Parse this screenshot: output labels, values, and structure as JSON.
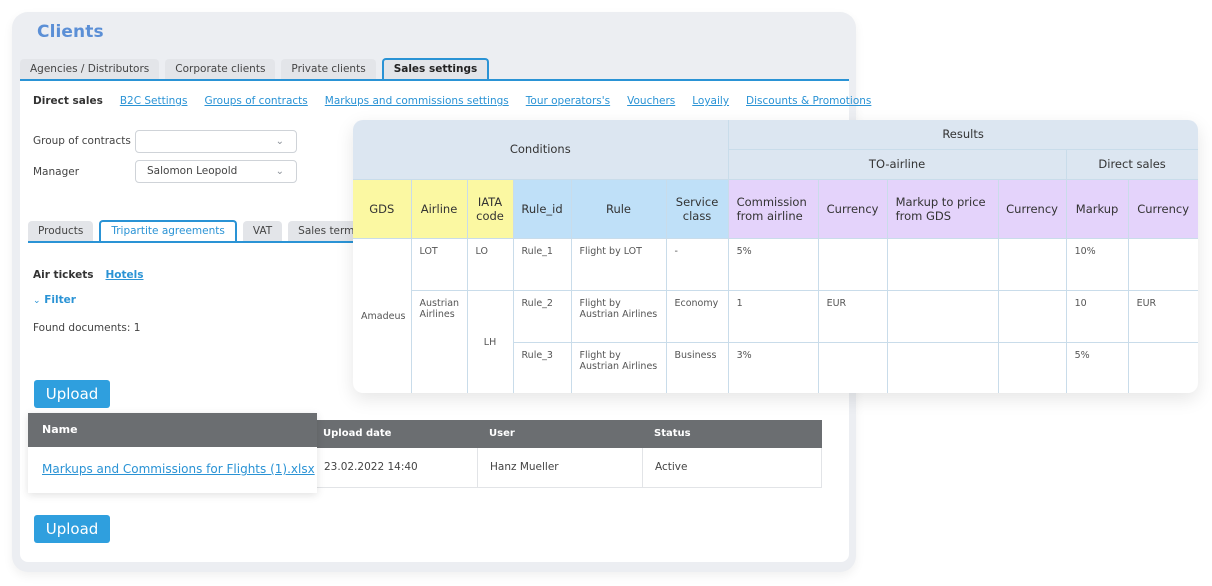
{
  "page": {
    "title": "Clients"
  },
  "top_tabs": [
    {
      "label": "Agencies / Distributors",
      "active": false
    },
    {
      "label": "Corporate clients",
      "active": false
    },
    {
      "label": "Private clients",
      "active": false
    },
    {
      "label": "Sales settings",
      "active": true
    }
  ],
  "subnav": {
    "current": "Direct sales",
    "links": [
      "B2C Settings",
      "Groups of contracts",
      "Markups and commissions settings",
      "Tour operators's",
      "Vouchers",
      "Loyaily",
      "Discounts & Promotions"
    ]
  },
  "form": {
    "group_of_contracts": {
      "label": "Group of contracts",
      "value": ""
    },
    "manager": {
      "label": "Manager",
      "value": "Salomon Leopold"
    }
  },
  "inner_tabs": [
    {
      "label": "Products",
      "active": false
    },
    {
      "label": "Tripartite agreements",
      "active": true
    },
    {
      "label": "VAT",
      "active": false
    },
    {
      "label": "Sales terms",
      "active": false
    }
  ],
  "category": {
    "current": "Air tickets",
    "link": "Hotels"
  },
  "filter_label": "Filter",
  "found_documents": "Found documents: 1",
  "upload_label": "Upload",
  "documents": {
    "headers": {
      "name": "Name",
      "upload_date": "Upload date",
      "user": "User",
      "status": "Status"
    },
    "rows": [
      {
        "name": "Markups and Commissions for Flights (1).xlsx",
        "upload_date": "23.02.2022 14:40",
        "user": "Hanz Mueller",
        "status": "Active"
      }
    ]
  },
  "rules_table": {
    "groups": {
      "conditions": "Conditions",
      "results": "Results",
      "to_airline": "TO-airline",
      "direct_sales": "Direct sales"
    },
    "columns": [
      "GDS",
      "Airline",
      "IATA code",
      "Rule_id",
      "Rule",
      "Service class",
      "Commission from airline",
      "Currency",
      "Markup to price from GDS",
      "Currency",
      "Markup",
      "Currency"
    ],
    "gds": "Amadeus",
    "rows": [
      {
        "airline": "LOT",
        "iata": "LO",
        "rule_id": "Rule_1",
        "rule": "Flight by LOT",
        "service_class": "-",
        "commission": "5%",
        "currency1": "",
        "markup_gds": "",
        "currency2": "",
        "markup": "10%",
        "currency3": ""
      },
      {
        "airline": "Austrian Airlines",
        "iata": "LH",
        "rule_id": "Rule_2",
        "rule": "Flight by Austrian Airlines",
        "service_class": "Economy",
        "commission": "1",
        "currency1": "EUR",
        "markup_gds": "",
        "currency2": "",
        "markup": "10",
        "currency3": "EUR"
      },
      {
        "airline": "",
        "iata": "",
        "rule_id": "Rule_3",
        "rule": "Flight by Austrian Airlines",
        "service_class": "Business",
        "commission": "3%",
        "currency1": "",
        "markup_gds": "",
        "currency2": "",
        "markup": "5%",
        "currency3": ""
      }
    ]
  }
}
